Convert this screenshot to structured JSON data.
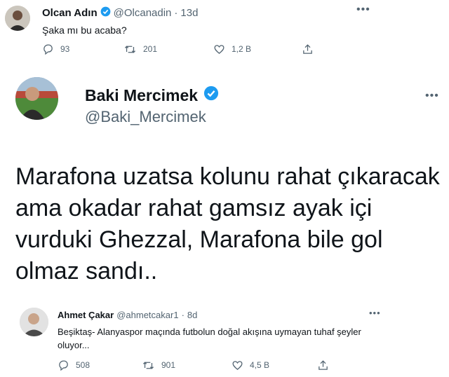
{
  "top_tweet": {
    "display_name": "Olcan Adın",
    "handle": "@Olcanadin",
    "separator": "·",
    "time": "13d",
    "text": "Şaka mı bu acaba?",
    "replies": "93",
    "retweets": "201",
    "likes": "1,2 B"
  },
  "quoted_tweet": {
    "display_name": "Baki Mercimek",
    "handle": "@Baki_Mercimek",
    "text": "Marafona uzatsa kolunu rahat çıkaracak ama okadar rahat gamsız ayak içi vurduki Ghezzal, Marafona bile gol olmaz sandı.."
  },
  "inner_tweet": {
    "display_name": "Ahmet Çakar",
    "handle": "@ahmetcakar1",
    "separator": "·",
    "time": "8d",
    "text": "Beşiktaş- Alanyaspor maçında futbolun doğal akışına uymayan tuhaf şeyler oluyor...",
    "replies": "508",
    "retweets": "901",
    "likes": "4,5 B"
  },
  "colors": {
    "verified": "#1d9bf0",
    "secondary_text": "#536471"
  },
  "icons": [
    "reply-icon",
    "retweet-icon",
    "like-icon",
    "share-icon",
    "verified-badge-icon",
    "more-icon"
  ]
}
